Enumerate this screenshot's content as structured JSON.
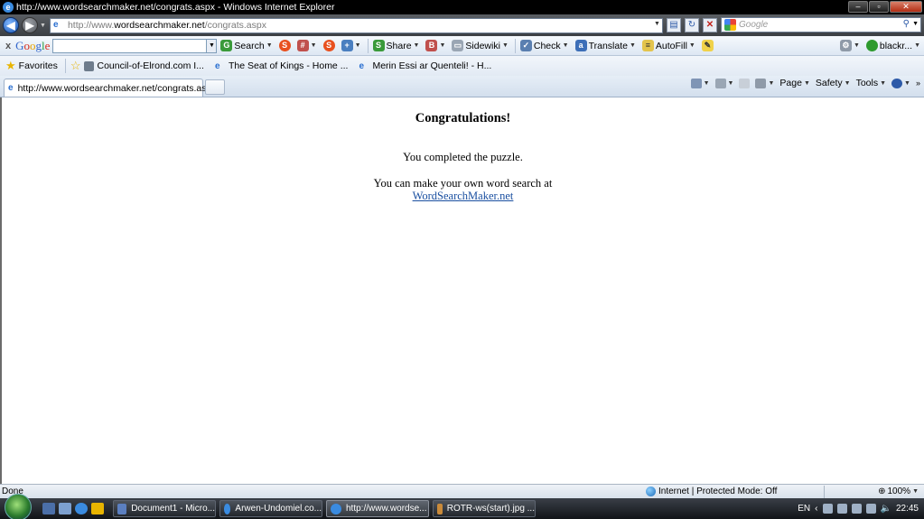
{
  "window": {
    "title": "http://www.wordsearchmaker.net/congrats.aspx - Windows Internet Explorer"
  },
  "address_bar": {
    "url_prefix": "http://www.",
    "url_domain": "wordsearchmaker.net",
    "url_path": "/congrats.aspx"
  },
  "search": {
    "placeholder": "Google"
  },
  "google_toolbar": {
    "logo": [
      "G",
      "o",
      "o",
      "g",
      "l",
      "e"
    ],
    "search_label": "Search",
    "share_label": "Share",
    "sidewiki_label": "Sidewiki",
    "check_label": "Check",
    "translate_label": "Translate",
    "autofill_label": "AutoFill",
    "account_label": "blackr..."
  },
  "favorites_bar": {
    "favorites_label": "Favorites",
    "items": [
      "Council-of-Elrond.com I...",
      "The Seat of Kings - Home ...",
      "Merin Essi ar Quenteli! - H..."
    ]
  },
  "tabs": {
    "active_tab_label": "http://www.wordsearchmaker.net/congrats.aspx"
  },
  "command_bar": {
    "page_label": "Page",
    "safety_label": "Safety",
    "tools_label": "Tools"
  },
  "content": {
    "heading": "Congratulations!",
    "completed_text": "You completed the puzzle.",
    "make_own_text": "You can make your own word search at",
    "link_text": "WordSearchMaker.net"
  },
  "status_bar": {
    "status": "Done",
    "zone": "Internet | Protected Mode: Off",
    "zoom": "100%"
  },
  "taskbar": {
    "buttons": [
      "Document1 - Micro...",
      "Arwen-Undomiel.co...",
      "http://www.wordse...",
      "ROTR-ws(start).jpg ..."
    ],
    "language": "EN",
    "clock": "22:45"
  },
  "colors": {
    "link": "#1a4fa0",
    "title_bar": "#000000",
    "toolbar_bg": "#dde7f3"
  }
}
